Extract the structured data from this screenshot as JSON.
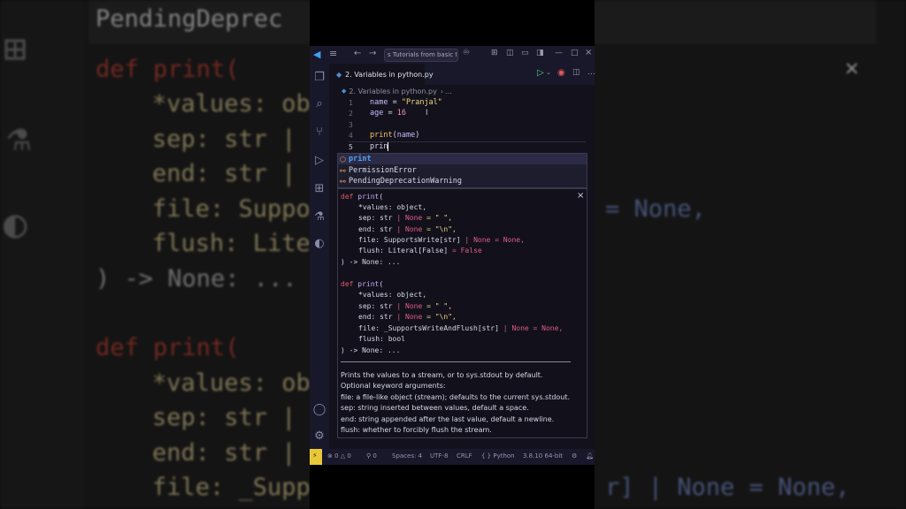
{
  "background": {
    "header_text": "PendingDeprec",
    "block1": {
      "l1": "def print(",
      "l2": "*values: ob",
      "l3": "sep: str |",
      "l4": "end: str |",
      "l5": "file: Suppo",
      "l5b": "= None,",
      "l6": "flush: Lite",
      "l7": ") -> None: ..."
    },
    "block2": {
      "l1": "def print(",
      "l2": "*values: ob",
      "l3": "sep: str |",
      "l4": "end: str |",
      "l5": "file: _Supp",
      "l5b": "r] | None = None,"
    },
    "close_symbol": "✕"
  },
  "titlebar": {
    "search_text": "s Tutorials from basic t"
  },
  "tab": {
    "label": "2. Variables in python.py"
  },
  "breadcrumb": {
    "file": "2. Variables in python.py",
    "more": "..."
  },
  "editor": {
    "lines": [
      {
        "num": "1",
        "var": "name",
        "op": " = ",
        "value": "\"Pranjal\""
      },
      {
        "num": "2",
        "var": "age",
        "op": " = ",
        "value": "16"
      },
      {
        "num": "3"
      },
      {
        "num": "4",
        "call": "print",
        "arg": "name"
      },
      {
        "num": "5",
        "typed": "prin"
      }
    ]
  },
  "suggestions": [
    {
      "icon": "method-icon",
      "label": "print"
    },
    {
      "icon": "class-icon",
      "label": "PermissionError"
    },
    {
      "icon": "class-icon",
      "label": "PendingDeprecationWarning"
    }
  ],
  "signature": {
    "close": "×",
    "sig1": {
      "def": "def",
      "name": "print",
      "values": "*values: object,",
      "sep": "sep: str",
      "sep_none": "None",
      "sep_default": "= \" \",",
      "end": "end: str",
      "end_none": "None",
      "end_default": "= \"\\n\",",
      "file": "file: SupportsWrite[str]",
      "file_none": "None",
      "file_default": "= None,",
      "flush": "flush: Literal[False]",
      "flush_default": "= False",
      "ret": ") -> None: ..."
    },
    "sig2": {
      "def": "def",
      "name": "print",
      "values": "*values: object,",
      "sep": "sep: str",
      "sep_none": "None",
      "sep_default": "= \" \",",
      "end": "end: str",
      "end_none": "None",
      "end_default": "= \"\\n\",",
      "file": "file: _SupportsWriteAndFlush[str]",
      "file_none": "None",
      "file_default": "= None,",
      "flush": "flush: bool",
      "ret": ") -> None: ..."
    },
    "doc": [
      "Prints the values to a stream, or to sys.stdout by default.",
      "Optional keyword arguments:",
      "file: a file-like object (stream); defaults to the current sys.stdout.",
      "sep: string inserted between values, default a space.",
      "end: string appended after the last value, default a newline.",
      "flush: whether to forcibly flush the stream."
    ]
  },
  "statusbar": {
    "errors": "0",
    "warnings": "0",
    "ports": "0",
    "spaces": "Spaces: 4",
    "encoding": "UTF-8",
    "eol": "CRLF",
    "language": "Python",
    "interpreter": "3.8.10 64-bit"
  },
  "colors": {
    "accent": "#4fa3ff",
    "keyword": "#e0566a",
    "string": "#f0d67c",
    "statusbar_bg": "#19182a"
  }
}
